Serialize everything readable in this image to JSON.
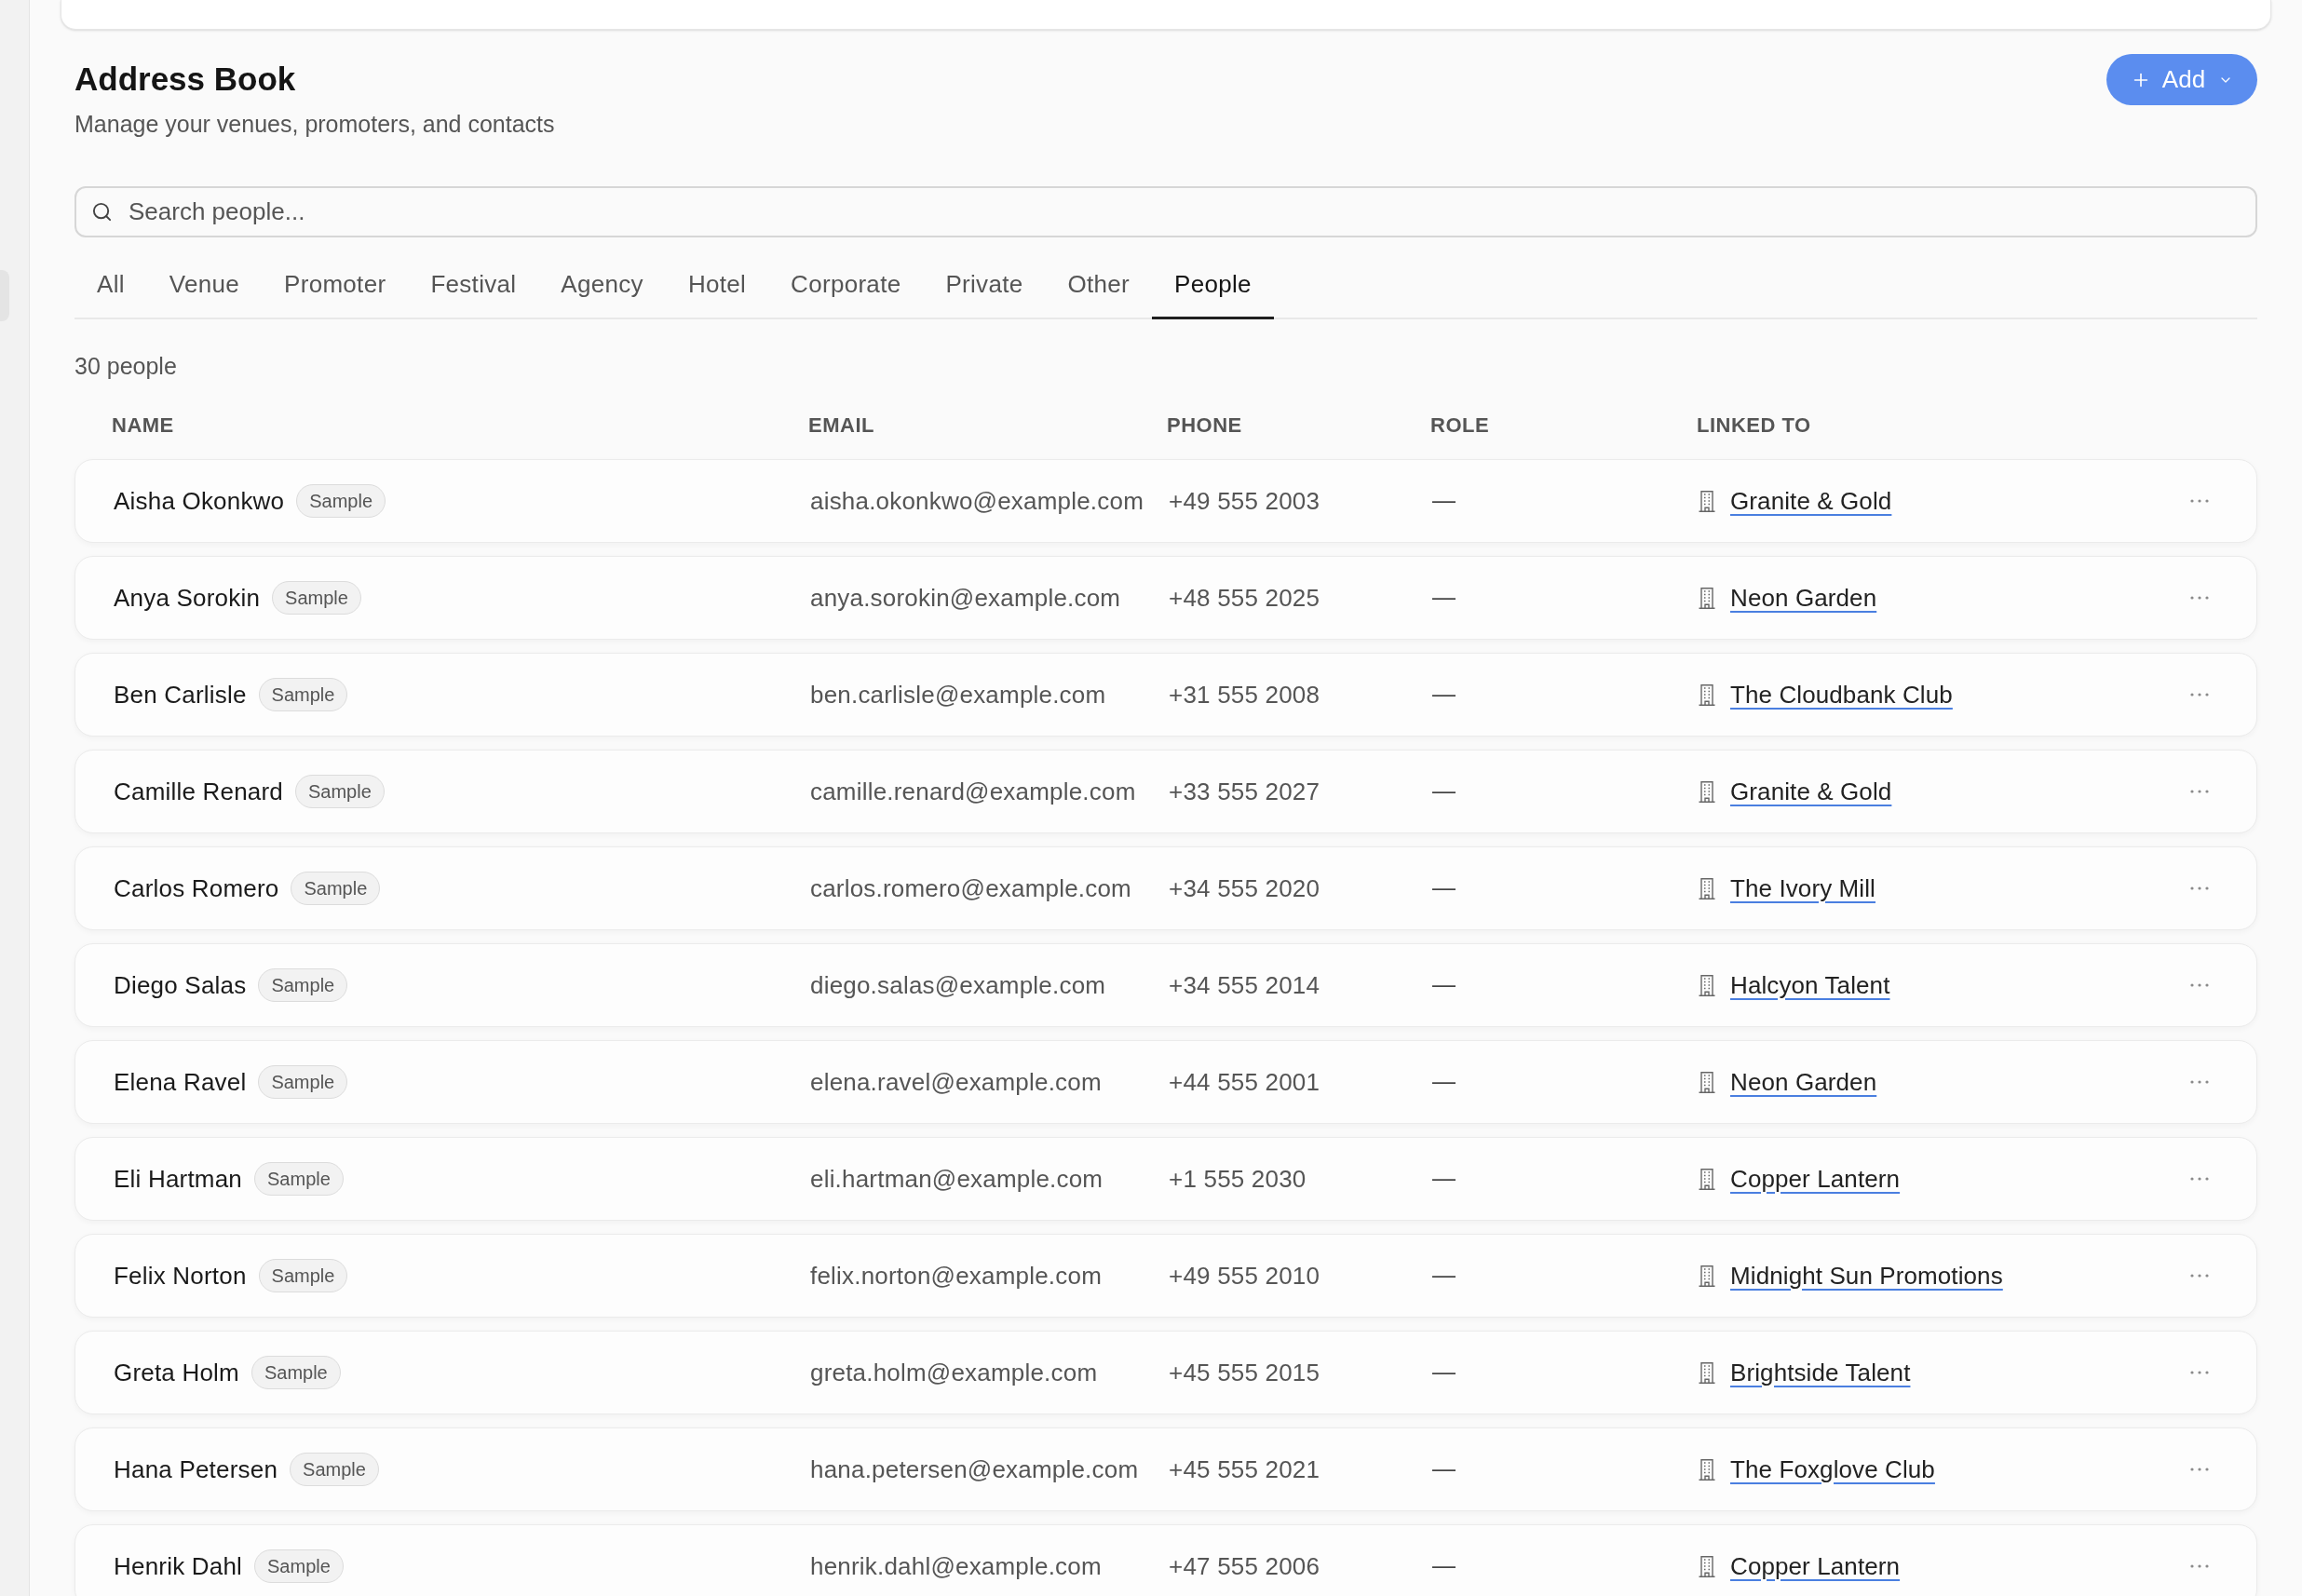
{
  "header": {
    "title": "Address Book",
    "subtitle": "Manage your venues, promoters, and contacts"
  },
  "add_button": {
    "label": "Add"
  },
  "search": {
    "placeholder": "Search people..."
  },
  "tabs": [
    {
      "label": "All",
      "selected": false
    },
    {
      "label": "Venue",
      "selected": false
    },
    {
      "label": "Promoter",
      "selected": false
    },
    {
      "label": "Festival",
      "selected": false
    },
    {
      "label": "Agency",
      "selected": false
    },
    {
      "label": "Hotel",
      "selected": false
    },
    {
      "label": "Corporate",
      "selected": false
    },
    {
      "label": "Private",
      "selected": false
    },
    {
      "label": "Other",
      "selected": false
    },
    {
      "label": "People",
      "selected": true
    }
  ],
  "count": "30 people",
  "table": {
    "columns": [
      "NAME",
      "EMAIL",
      "PHONE",
      "ROLE",
      "LINKED TO"
    ],
    "rows": [
      {
        "name": "Aisha Okonkwo",
        "badge": "Sample",
        "email": "aisha.okonkwo@example.com",
        "phone": "+49 555 2003",
        "role": "—",
        "linked_to": "Granite & Gold"
      },
      {
        "name": "Anya Sorokin",
        "badge": "Sample",
        "email": "anya.sorokin@example.com",
        "phone": "+48 555 2025",
        "role": "—",
        "linked_to": "Neon Garden"
      },
      {
        "name": "Ben Carlisle",
        "badge": "Sample",
        "email": "ben.carlisle@example.com",
        "phone": "+31 555 2008",
        "role": "—",
        "linked_to": "The Cloudbank Club"
      },
      {
        "name": "Camille Renard",
        "badge": "Sample",
        "email": "camille.renard@example.com",
        "phone": "+33 555 2027",
        "role": "—",
        "linked_to": "Granite & Gold"
      },
      {
        "name": "Carlos Romero",
        "badge": "Sample",
        "email": "carlos.romero@example.com",
        "phone": "+34 555 2020",
        "role": "—",
        "linked_to": "The Ivory Mill"
      },
      {
        "name": "Diego Salas",
        "badge": "Sample",
        "email": "diego.salas@example.com",
        "phone": "+34 555 2014",
        "role": "—",
        "linked_to": "Halcyon Talent"
      },
      {
        "name": "Elena Ravel",
        "badge": "Sample",
        "email": "elena.ravel@example.com",
        "phone": "+44 555 2001",
        "role": "—",
        "linked_to": "Neon Garden"
      },
      {
        "name": "Eli Hartman",
        "badge": "Sample",
        "email": "eli.hartman@example.com",
        "phone": "+1 555 2030",
        "role": "—",
        "linked_to": "Copper Lantern"
      },
      {
        "name": "Felix Norton",
        "badge": "Sample",
        "email": "felix.norton@example.com",
        "phone": "+49 555 2010",
        "role": "—",
        "linked_to": "Midnight Sun Promotions"
      },
      {
        "name": "Greta Holm",
        "badge": "Sample",
        "email": "greta.holm@example.com",
        "phone": "+45 555 2015",
        "role": "—",
        "linked_to": "Brightside Talent"
      },
      {
        "name": "Hana Petersen",
        "badge": "Sample",
        "email": "hana.petersen@example.com",
        "phone": "+45 555 2021",
        "role": "—",
        "linked_to": "The Foxglove Club"
      },
      {
        "name": "Henrik Dahl",
        "badge": "Sample",
        "email": "henrik.dahl@example.com",
        "phone": "+47 555 2006",
        "role": "—",
        "linked_to": "Copper Lantern"
      }
    ]
  }
}
